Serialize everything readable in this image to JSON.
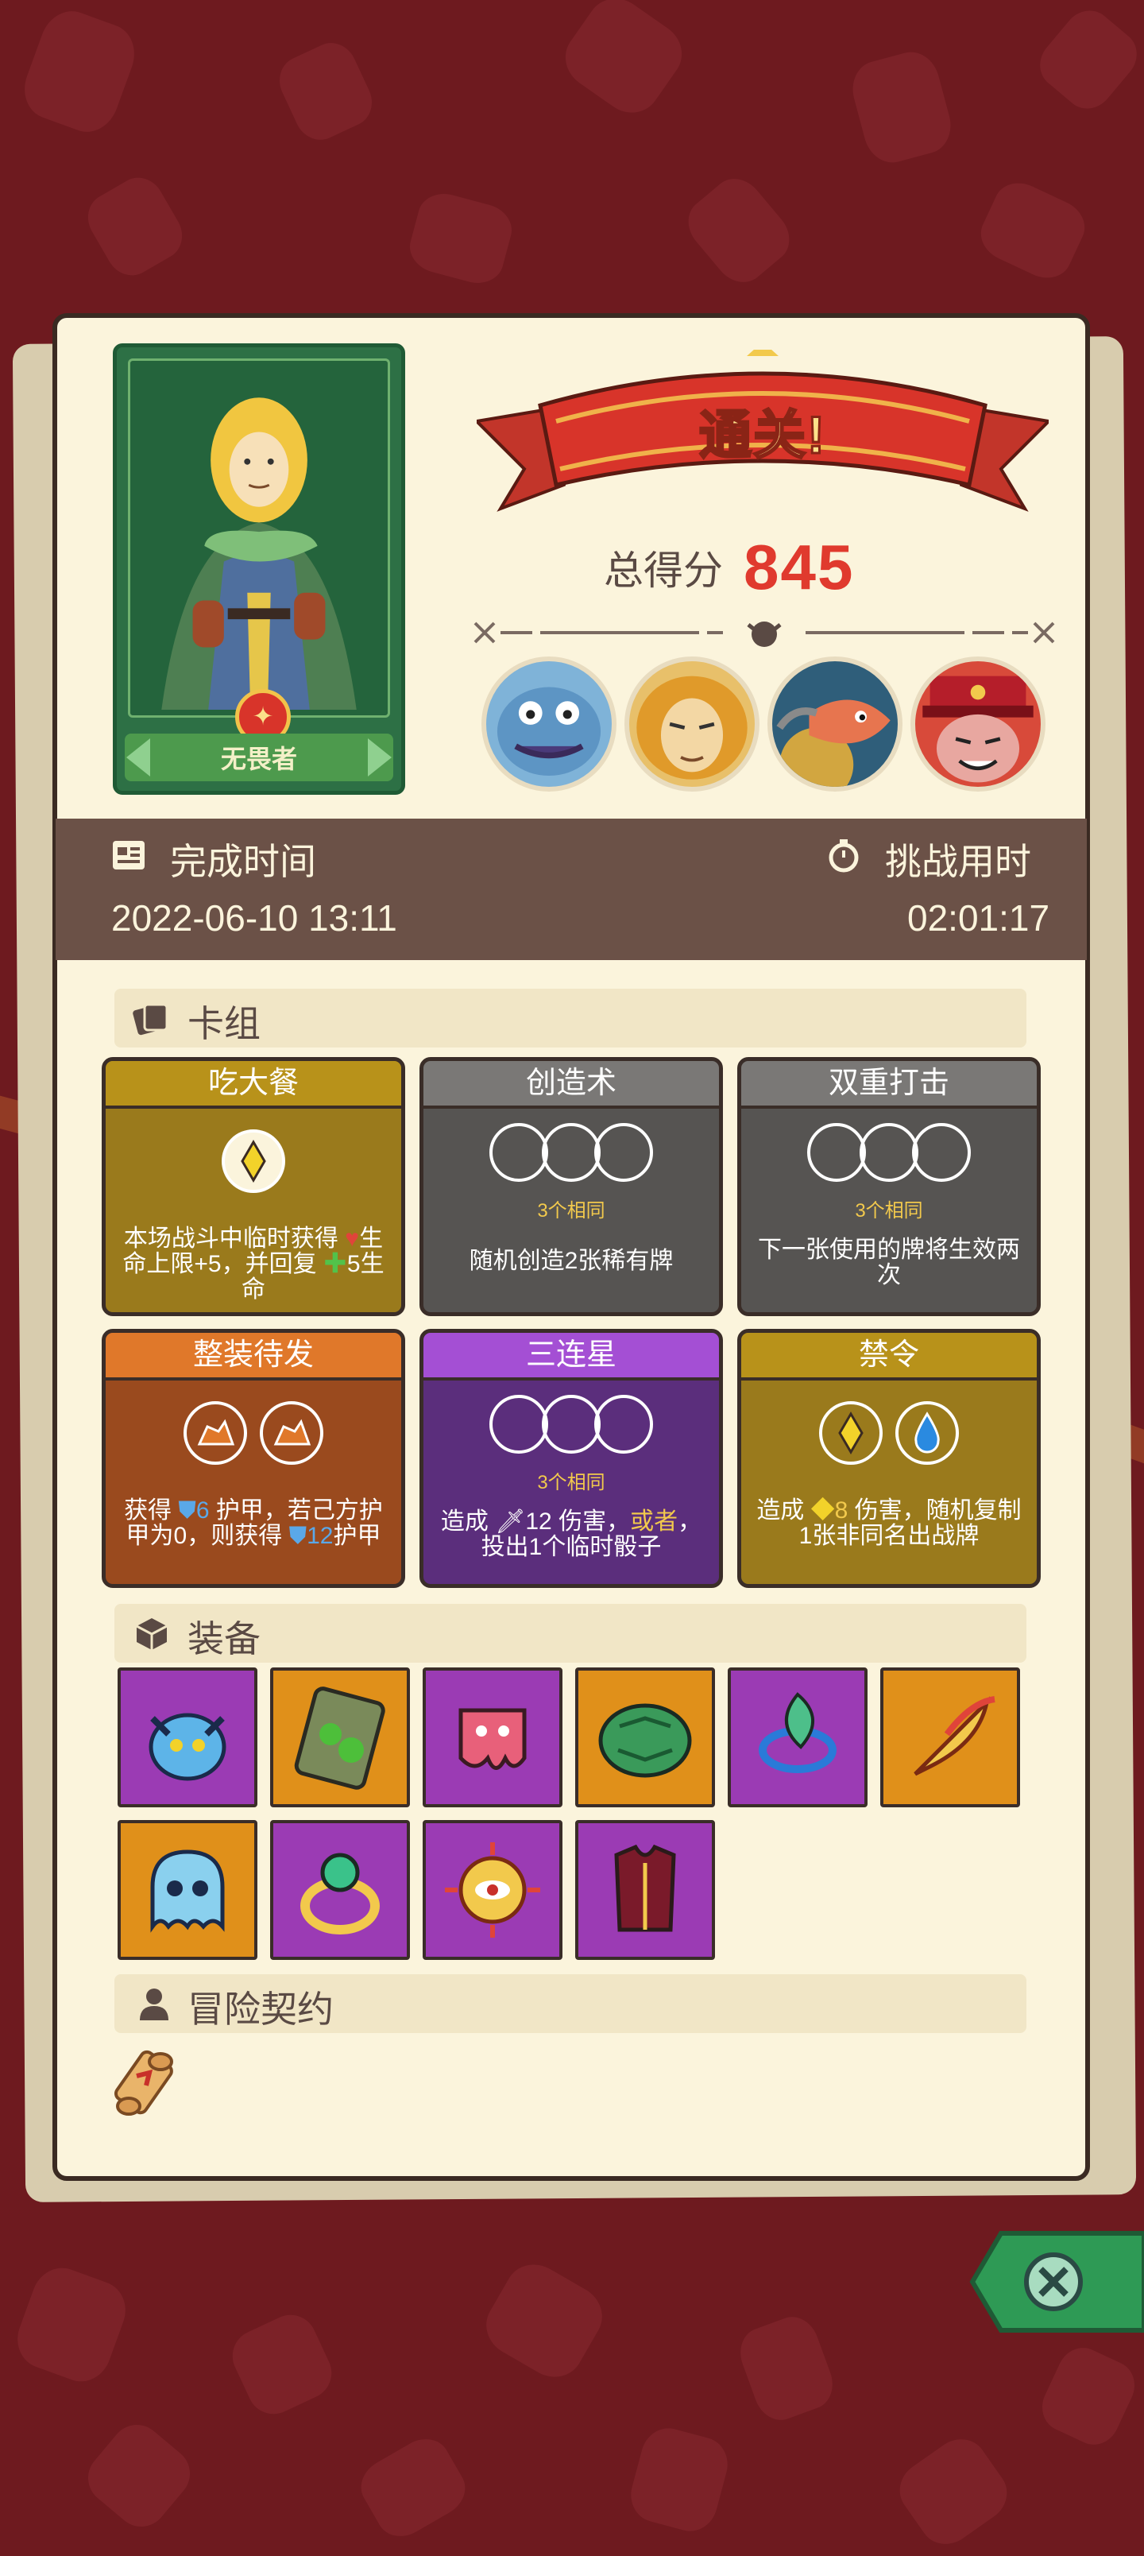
{
  "hero": {
    "name": "无畏者",
    "name_icon": "badge-emblem-icon"
  },
  "result": {
    "banner": "通关!",
    "score_label": "总得分",
    "score": "845"
  },
  "bosses": [
    {
      "name": "blue-toad-boss-portrait"
    },
    {
      "name": "golden-lion-boss-portrait"
    },
    {
      "name": "fish-boss-portrait"
    },
    {
      "name": "red-hat-boss-portrait"
    }
  ],
  "times": {
    "finish_label": "完成时间",
    "finish_value": "2022-06-10 13:11",
    "challenge_label": "挑战用时",
    "challenge_value": "02:01:17"
  },
  "sections": {
    "deck": "卡组",
    "equipment": "装备",
    "contract": "冒险契约"
  },
  "cards": [
    {
      "title": "吃大餐",
      "color": "#9a7a1c",
      "head_color": "#b8921a",
      "desc_parts": [
        "本场战斗中临时获得 ",
        "♥",
        "生命上限+5，并回复 ",
        "✚",
        "5生命"
      ]
    },
    {
      "title": "创造术",
      "color": "#565452",
      "head_color": "#7a7876",
      "same": "3个相同",
      "desc": "随机创造2张稀有牌"
    },
    {
      "title": "双重打击",
      "color": "#565452",
      "head_color": "#7a7876",
      "same": "3个相同",
      "desc": "下一张使用的牌将生效两次"
    },
    {
      "title": "整装待发",
      "color": "#9a4a1e",
      "head_color": "#e0782a",
      "desc_parts": [
        "获得 ",
        "6",
        " 护甲，若己方护甲为0，则获得 ",
        "12",
        "护甲"
      ]
    },
    {
      "title": "三连星",
      "color": "#5b2e7c",
      "head_color": "#a44fd4",
      "same": "3个相同",
      "desc_parts": [
        "造成 ",
        "12",
        " 伤害，",
        "或者",
        "，投出1个临时骰子"
      ]
    },
    {
      "title": "禁令",
      "color": "#9a7a1c",
      "head_color": "#b8921a",
      "desc_parts": [
        "造成 ",
        "8",
        " 伤害，随机复制1张非同名出战牌"
      ]
    }
  ],
  "gear_colors": {
    "purple": "#9b3bb4",
    "orange": "#e0901a"
  },
  "gear": [
    {
      "name": "blue-demon-helm-icon",
      "bg": "purple"
    },
    {
      "name": "moss-stone-tablet-icon",
      "bg": "orange"
    },
    {
      "name": "pink-slime-cube-icon",
      "bg": "purple"
    },
    {
      "name": "turtle-shell-icon",
      "bg": "orange"
    },
    {
      "name": "leaf-ring-icon",
      "bg": "purple"
    },
    {
      "name": "phoenix-feather-icon",
      "bg": "orange"
    },
    {
      "name": "blue-ghost-icon",
      "bg": "orange"
    },
    {
      "name": "emerald-ring-icon",
      "bg": "purple"
    },
    {
      "name": "sun-eye-amulet-icon",
      "bg": "purple"
    },
    {
      "name": "crimson-vest-icon",
      "bg": "purple"
    }
  ],
  "contract_item": "scroll-icon",
  "close": "close-icon"
}
